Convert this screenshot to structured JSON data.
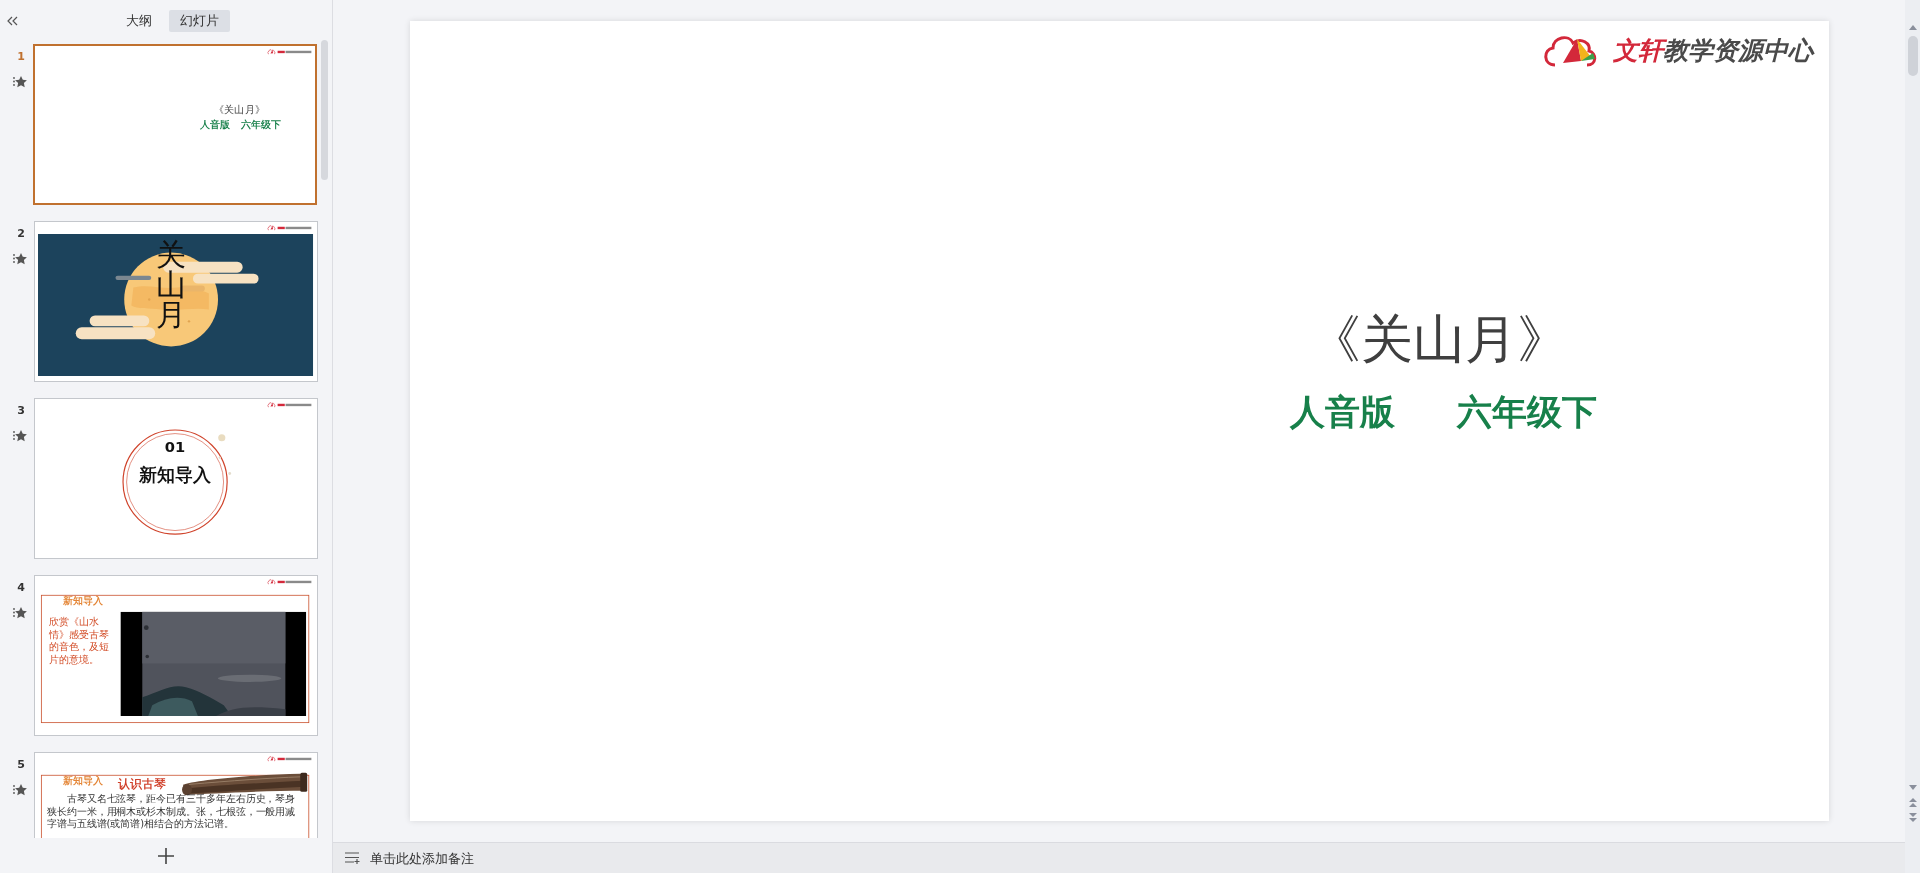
{
  "sidebar": {
    "tabs": [
      {
        "label": "大纲",
        "selected": false
      },
      {
        "label": "幻灯片",
        "selected": true
      }
    ],
    "slides": [
      {
        "number": "1",
        "selected": true,
        "kind": "title",
        "title": "《关山月》",
        "subtitle": [
          "人音版",
          "六年级下"
        ]
      },
      {
        "number": "2",
        "selected": false,
        "kind": "cover",
        "title": "关山月"
      },
      {
        "number": "3",
        "selected": false,
        "kind": "section",
        "index": "01",
        "title": "新知导入"
      },
      {
        "number": "4",
        "selected": false,
        "kind": "video",
        "tag": "新知导入",
        "text": "欣赏《山水情》感受古琴的音色，及短片的意境。"
      },
      {
        "number": "5",
        "selected": false,
        "kind": "article",
        "tag": "新知导入",
        "title": "认识古琴",
        "body": "古琴又名七弦琴，距今已有三千多年左右历史，琴身狭长约一米，用桐木或杉木制成。张，七根弦，一般用减字谱与五线谱(或简谱)相结合的方法记谱。"
      }
    ]
  },
  "editor": {
    "slide": {
      "kind": "title",
      "logo": {
        "brand": "文轩",
        "name": "教学资源中心"
      },
      "title": "《关山月》",
      "subtitle": [
        "人音版",
        "六年级下"
      ]
    }
  },
  "notes": {
    "placeholder": "单击此处添加备注"
  }
}
